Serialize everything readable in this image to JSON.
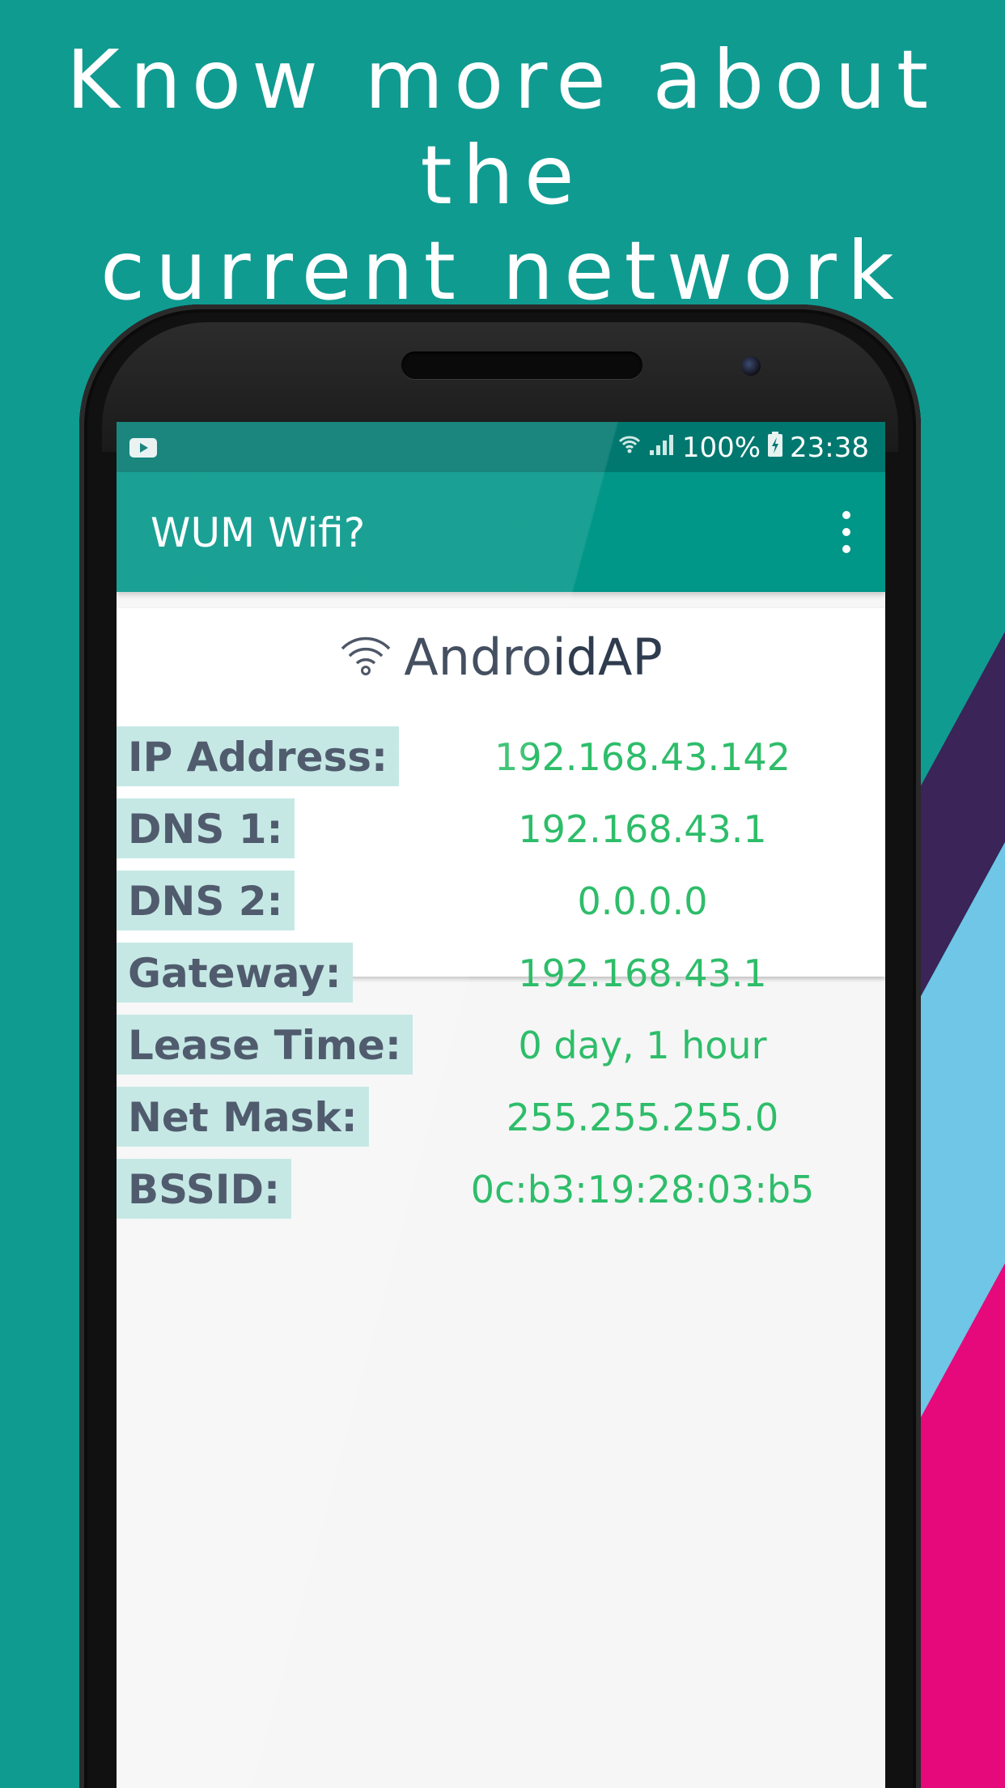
{
  "headline": "Know more about the\ncurrent network",
  "colors": {
    "background": "#109b91",
    "band_purple": "#3a2458",
    "band_blue": "#6fc6e6",
    "band_pink": "#e5097b",
    "appbar": "#009688",
    "statusbar": "#00786f",
    "label_bg": "#bfe6e2",
    "value_text": "#2ebd6a"
  },
  "statusbar": {
    "battery": "100%",
    "time": "23:38",
    "icons": [
      "youtube-icon",
      "wifi-icon",
      "signal-icon",
      "battery-charging-icon"
    ]
  },
  "appbar": {
    "title": "WUM Wifi?",
    "menu_icon": "overflow-menu-icon"
  },
  "network": {
    "ssid": "AndroidAP",
    "ssid_icon": "wifi-icon",
    "rows": [
      {
        "label": "IP Address:",
        "value": "192.168.43.142"
      },
      {
        "label": "DNS 1:",
        "value": "192.168.43.1"
      },
      {
        "label": "DNS 2:",
        "value": "0.0.0.0"
      },
      {
        "label": "Gateway:",
        "value": "192.168.43.1"
      },
      {
        "label": "Lease Time:",
        "value": "0 day, 1 hour"
      },
      {
        "label": "Net Mask:",
        "value": "255.255.255.0"
      },
      {
        "label": "BSSID:",
        "value": "0c:b3:19:28:03:b5"
      }
    ]
  }
}
